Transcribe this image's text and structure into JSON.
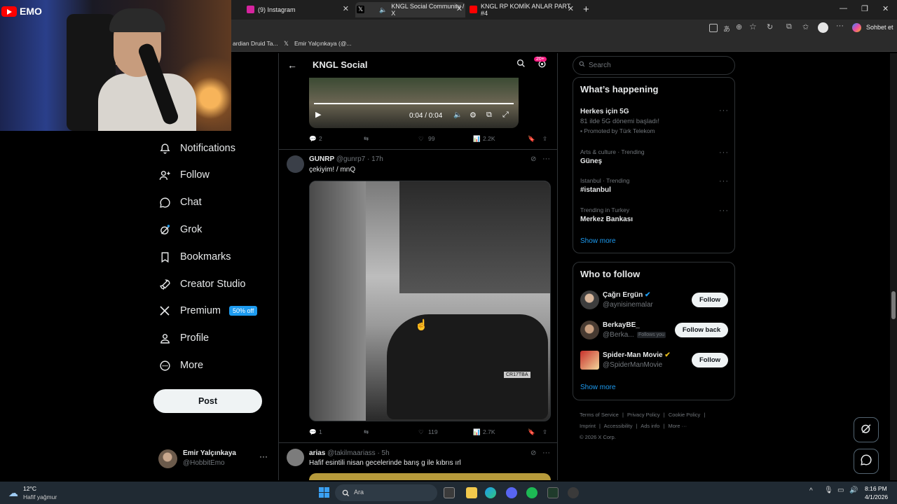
{
  "tabs": [
    {
      "label": "(9) Instagram",
      "color": "#d6249f"
    },
    {
      "label": "KNGL Social Community / X",
      "color": "#ffffff"
    },
    {
      "label": "KNGL RP KOMİK ANLAR PART #4",
      "color": "#ff0000"
    }
  ],
  "browser": {
    "chat_label": "Sohbet et",
    "bookmarks": [
      "ardian Druid Ta...",
      "Emir Yalçınkaya (@..."
    ]
  },
  "stream": {
    "channel": "EMO"
  },
  "nav": {
    "items": [
      {
        "label": "Notifications",
        "icon": "bell-icon"
      },
      {
        "label": "Follow",
        "icon": "person-plus-icon"
      },
      {
        "label": "Chat",
        "icon": "chat-bubble-icon"
      },
      {
        "label": "Grok",
        "icon": "grok-icon"
      },
      {
        "label": "Bookmarks",
        "icon": "bookmark-icon"
      },
      {
        "label": "Creator Studio",
        "icon": "rocket-icon"
      },
      {
        "label": "Premium",
        "icon": "x-logo-icon"
      },
      {
        "label": "Profile",
        "icon": "person-icon"
      },
      {
        "label": "More",
        "icon": "more-circle-icon"
      }
    ],
    "premium_badge": "50% off",
    "post_label": "Post"
  },
  "account": {
    "name": "Emir Yalçınkaya",
    "handle": "@HobbitEmo",
    "more": "···"
  },
  "header": {
    "title": "KNGL Social",
    "notif_count": "20+"
  },
  "video": {
    "time": "0:04 / 0:04"
  },
  "posts": [
    {
      "replies": "2",
      "likes": "99",
      "views": "2.2K"
    },
    {
      "name": "GUNRP",
      "handle": "@gunrp7",
      "time": "· 17h",
      "text": "çekiyim! / mnQ",
      "replies": "1",
      "likes": "119",
      "views": "2.7K",
      "image_plate": "CR17TBA"
    },
    {
      "name": "arias",
      "handle": "@takilmaariass",
      "time": "· 5h",
      "text": "Hafif esintili nisan gecelerinde barış g ile kıbrıs ırl"
    }
  ],
  "right": {
    "search_placeholder": "Search",
    "whats_happening": "What’s happening",
    "trends": [
      {
        "title": "Herkes için 5G",
        "desc": "81 ilde 5G dönemi başladı!",
        "promo": "Promoted by Türk Telekom"
      },
      {
        "meta": "Arts & culture · Trending",
        "title": "Güneş"
      },
      {
        "meta": "Istanbul · Trending",
        "title": "#istanbul"
      },
      {
        "meta": "Trending in Turkey",
        "title": "Merkez Bankası"
      }
    ],
    "show_more": "Show more",
    "who_to_follow": "Who to follow",
    "follow": [
      {
        "name": "Çağrı Ergün",
        "handle": "@aynisinemalar",
        "button": "Follow"
      },
      {
        "name": "BerkayBE_",
        "handle": "@Berka...",
        "follows_you": "Follows you",
        "button": "Follow back"
      },
      {
        "name": "Spider-Man Movie",
        "handle": "@SpiderManMovie",
        "button": "Follow"
      }
    ],
    "show_more_2": "Show more",
    "footer": [
      "Terms of Service",
      "|",
      "Privacy Policy",
      "|",
      "Cookie Policy",
      "|",
      "Imprint",
      "|",
      "Accessibility",
      "|",
      "Ads info",
      "|",
      "More ···",
      "© 2026 X Corp."
    ]
  },
  "taskbar": {
    "weather_temp": "12°C",
    "weather_desc": "Hafif yağmur",
    "search": "Ara",
    "time": "8:16 PM",
    "date": "4/1/2026"
  }
}
